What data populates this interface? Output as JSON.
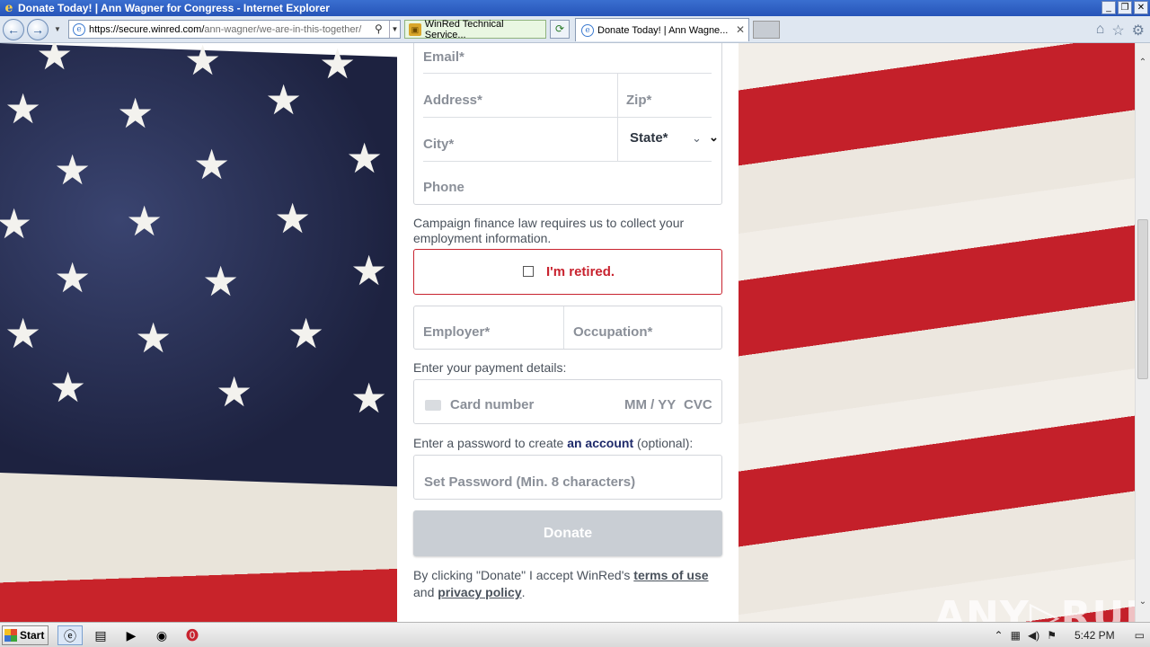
{
  "window": {
    "title": "Donate Today! | Ann Wagner for Congress - Internet Explorer",
    "controls": {
      "minimize": "_",
      "restore": "❐",
      "close": "✕"
    }
  },
  "browser": {
    "url_host": "https://secure.winred.com/",
    "url_path": "ann-wagner/we-are-in-this-together/",
    "security_label": "WinRed Technical Service...",
    "tab_title": "Donate Today! | Ann Wagne...",
    "icons": [
      "home-icon",
      "star-icon",
      "gear-icon"
    ]
  },
  "form": {
    "email_placeholder": "Email*",
    "address_placeholder": "Address*",
    "zip_placeholder": "Zip*",
    "city_placeholder": "City*",
    "state_value": "State*",
    "phone_placeholder": "Phone",
    "employment_note": "Campaign finance law requires us to collect your employment information.",
    "retired_label": "I'm retired.",
    "employer_placeholder": "Employer*",
    "occupation_placeholder": "Occupation*",
    "payment_note": "Enter your payment details:",
    "card_placeholder": "Card number",
    "expiry_placeholder": "MM / YY",
    "cvc_placeholder": "CVC",
    "password_note_before": "Enter a password to create",
    "password_note_link": "an account",
    "password_note_after": "(optional):",
    "password_placeholder": "Set Password (Min. 8 characters)",
    "donate_label": "Donate",
    "legal_before": "By clicking \"Donate\" I accept WinRed's",
    "legal_terms": "terms of use",
    "legal_and": "and",
    "legal_privacy": "privacy policy",
    "legal_end": "."
  },
  "watermark": "ANY▷RUN",
  "taskbar": {
    "start_label": "Start",
    "clock": "5:42 PM"
  },
  "colors": {
    "accent_red": "#c8232f",
    "button_disabled": "#c9ced4",
    "flag_blue": "#1d2240",
    "flag_red": "#c4202a"
  }
}
